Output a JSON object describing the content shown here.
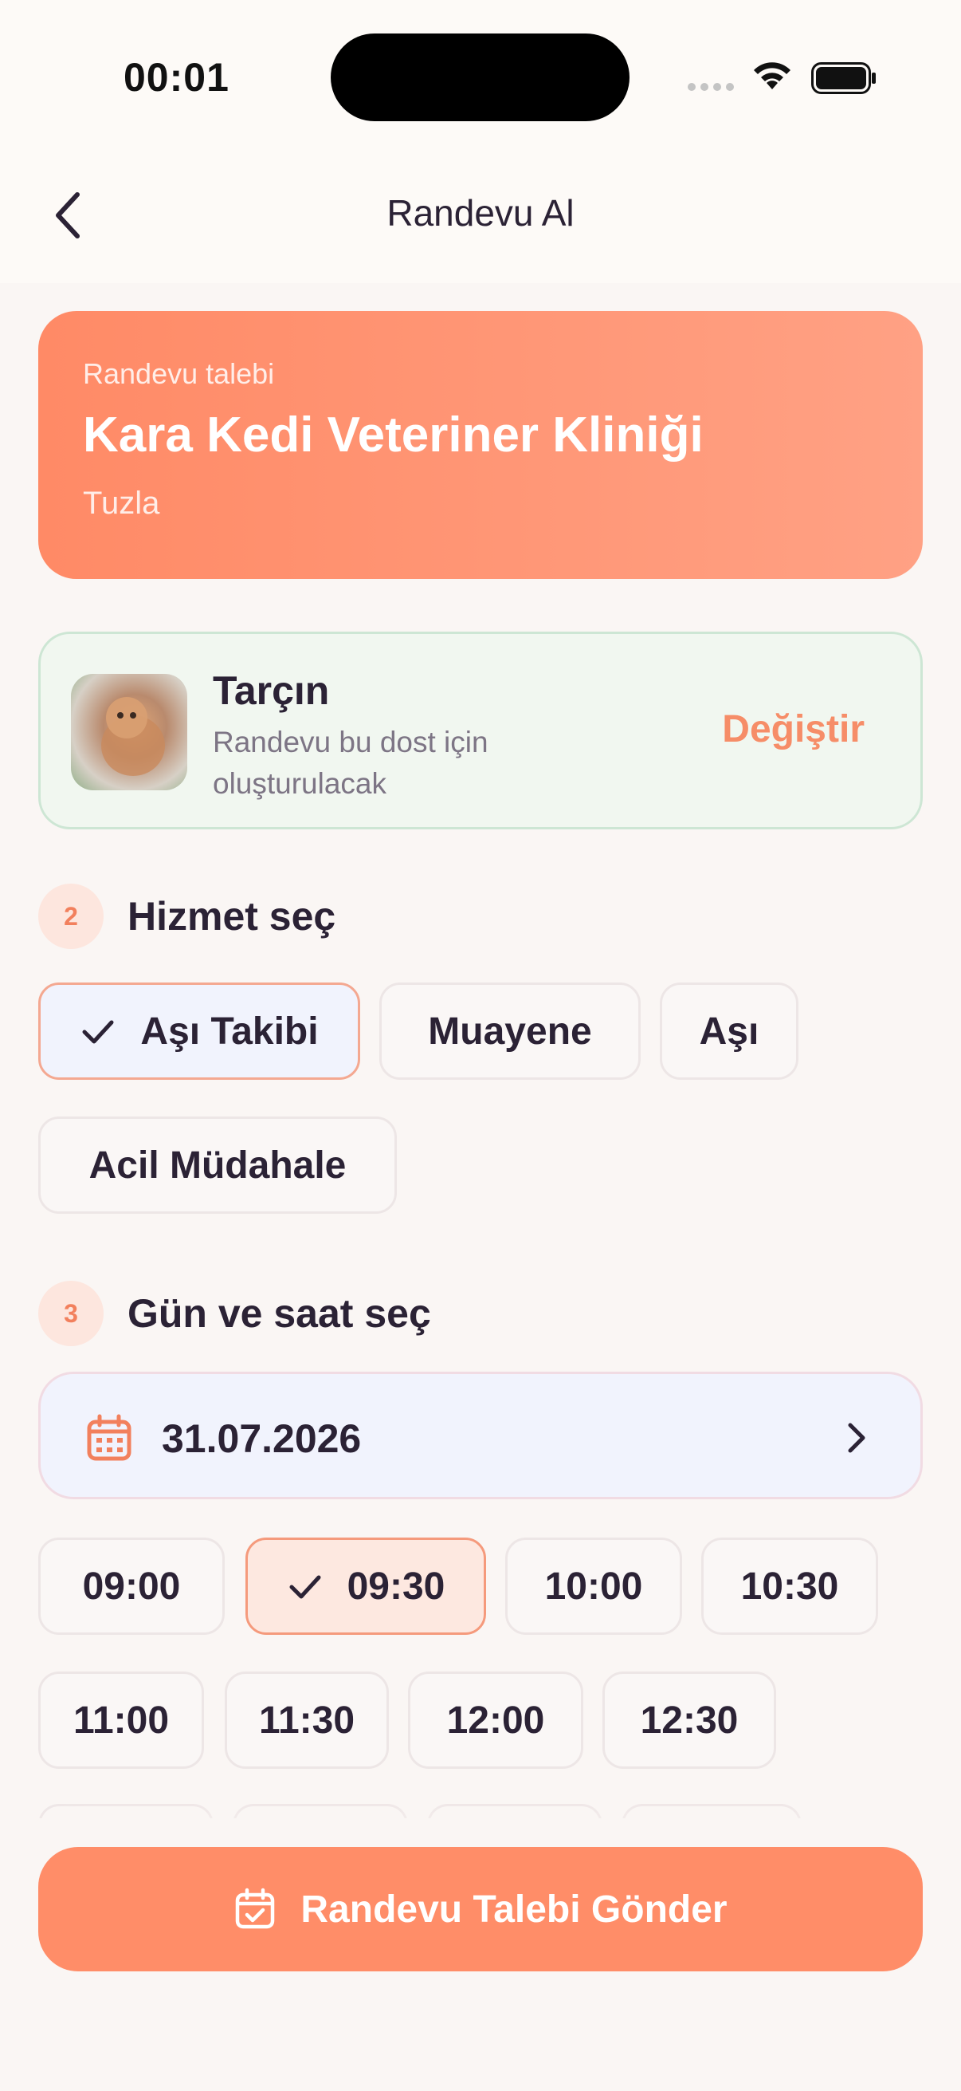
{
  "status_bar": {
    "time": "00:01"
  },
  "navbar": {
    "title": "Randevu Al"
  },
  "clinic": {
    "eyebrow": "Randevu talebi",
    "name": "Kara Kedi Veteriner Kliniği",
    "district": "Tuzla"
  },
  "pet": {
    "name": "Tarçın",
    "subtitle": "Randevu bu dost için oluşturulacak",
    "change_label": "Değiştir"
  },
  "service_section": {
    "step": "2",
    "title": "Hizmet seç",
    "options": [
      "Aşı Takibi",
      "Muayene",
      "Aşı",
      "Acil Müdahale"
    ],
    "selected": "Aşı Takibi"
  },
  "datetime_section": {
    "step": "3",
    "title": "Gün ve saat seç",
    "date": "31.07.2026",
    "times": [
      "09:00",
      "09:30",
      "10:00",
      "10:30",
      "11:00",
      "11:30",
      "12:00",
      "12:30"
    ],
    "selected_time": "09:30"
  },
  "submit": {
    "label": "Randevu Talebi Gönder"
  },
  "colors": {
    "accent": "#ff8d68",
    "pet_card_bg": "#f1f7f0",
    "selected_time_bg": "#fde8e0"
  }
}
